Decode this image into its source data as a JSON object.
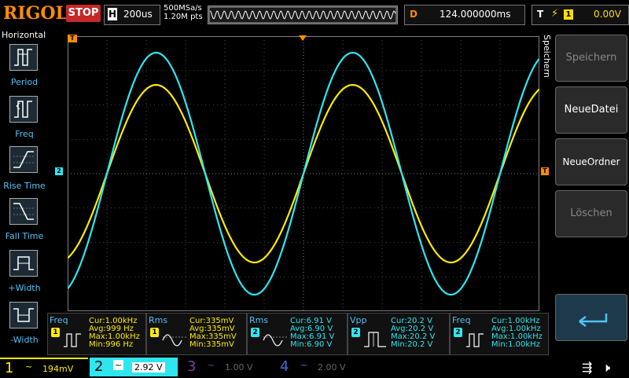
{
  "top": {
    "logo": "RIGOL",
    "run_state": "STOP",
    "horizontal_label": "H",
    "timebase": "200us",
    "sample_rate": "500MSa/s",
    "memory_depth": "1.20M pts",
    "delay_label": "D",
    "delay_value": "124.000000ms",
    "trigger_label": "T",
    "trigger_edge": "rising-edge-icon",
    "trigger_channel": "1",
    "trigger_level": "0.00V"
  },
  "left_panel": {
    "title": "Horizontal",
    "items": [
      {
        "label": "Period",
        "icon": "period-icon"
      },
      {
        "label": "Freq",
        "icon": "freq-icon"
      },
      {
        "label": "Rise Time",
        "icon": "rise-time-icon"
      },
      {
        "label": "Fall Time",
        "icon": "fall-time-icon"
      },
      {
        "label": "+Width",
        "icon": "pos-width-icon"
      },
      {
        "label": "-Width",
        "icon": "neg-width-icon"
      }
    ]
  },
  "right_panel": {
    "title": "Speichern",
    "buttons": [
      {
        "label": "Speichern",
        "enabled": false
      },
      {
        "label": "NeueDatei",
        "enabled": true
      },
      {
        "label": "NeueOrdner",
        "enabled": true
      },
      {
        "label": "Löschen",
        "enabled": false
      }
    ],
    "enter_icon": "enter-icon"
  },
  "markers": {
    "trigger_marker": "T",
    "ch2_marker": "2"
  },
  "waveforms": {
    "colors": {
      "ch1": "#ffeb00",
      "ch2": "#2ee6f0",
      "grid": "#808080"
    }
  },
  "measurements": [
    {
      "name": "Freq",
      "channel": "1",
      "cur": "Cur:1.00kHz",
      "avg": "Avg:999 Hz",
      "max": "Max:1.00kHz",
      "min": "Min:996 Hz"
    },
    {
      "name": "Rms",
      "channel": "1",
      "cur": "Cur:335mV",
      "avg": "Avg:335mV",
      "max": "Max:335mV",
      "min": "Min:335mV"
    },
    {
      "name": "Rms",
      "channel": "2",
      "cur": "Cur:6.91 V",
      "avg": "Avg:6.90 V",
      "max": "Max:6.91 V",
      "min": "Min:6.90 V"
    },
    {
      "name": "Vpp",
      "channel": "2",
      "cur": "Cur:20.2 V",
      "avg": "Avg:20.2 V",
      "max": "Max:20.2 V",
      "min": "Min:20.2 V"
    },
    {
      "name": "Freq",
      "channel": "2",
      "cur": "Cur:1.00kHz",
      "avg": "Avg:1.00kHz",
      "max": "Max:1.00kHz",
      "min": "Min:1.00kHz"
    }
  ],
  "channels": [
    {
      "num": "1",
      "coupling": "~",
      "scale": "194mV",
      "color": "#ffeb00",
      "active": true
    },
    {
      "num": "2",
      "coupling": "~",
      "scale": "2.92 V",
      "color": "#2ee6f0",
      "active": true
    },
    {
      "num": "3",
      "coupling": "~",
      "scale": "1.00 V",
      "color": "#7b3fa0",
      "active": false
    },
    {
      "num": "4",
      "coupling": "~",
      "scale": "2.00 V",
      "color": "#3f6fd0",
      "active": false
    }
  ],
  "status_icons": [
    "usb-icon",
    "speaker-muted-icon"
  ]
}
